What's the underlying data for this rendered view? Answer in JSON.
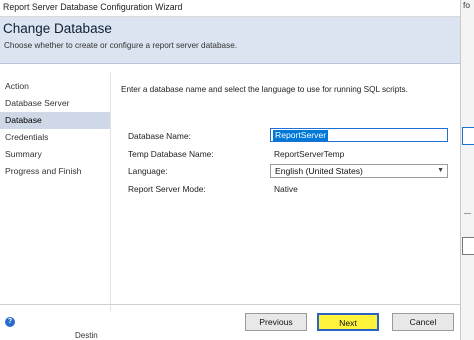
{
  "window": {
    "title": "Report Server Database Configuration Wizard"
  },
  "background": {
    "edge_text": "fo",
    "bottom_text": "Destin"
  },
  "header": {
    "title": "Change Database",
    "subtitle": "Choose whether to create or configure a report server database."
  },
  "nav": {
    "items": [
      {
        "label": "Action"
      },
      {
        "label": "Database Server"
      },
      {
        "label": "Database",
        "selected": true
      },
      {
        "label": "Credentials"
      },
      {
        "label": "Summary"
      },
      {
        "label": "Progress and Finish"
      }
    ]
  },
  "main": {
    "instruction": "Enter a database name and select the language to use for running SQL scripts.",
    "fields": {
      "database_name_label": "Database Name:",
      "database_name_value": "ReportServer",
      "temp_db_label": "Temp Database Name:",
      "temp_db_value": "ReportServerTemp",
      "language_label": "Language:",
      "language_value": "English (United States)",
      "mode_label": "Report Server Mode:",
      "mode_value": "Native"
    }
  },
  "footer": {
    "help_icon": "?",
    "previous_label": "Previous",
    "next_label": "Next",
    "cancel_label": "Cancel"
  },
  "colors": {
    "header_bg": "#dbe4f0",
    "nav_selected": "#cfd8e6",
    "accent": "#0078d7",
    "highlight": "#fff33b"
  }
}
